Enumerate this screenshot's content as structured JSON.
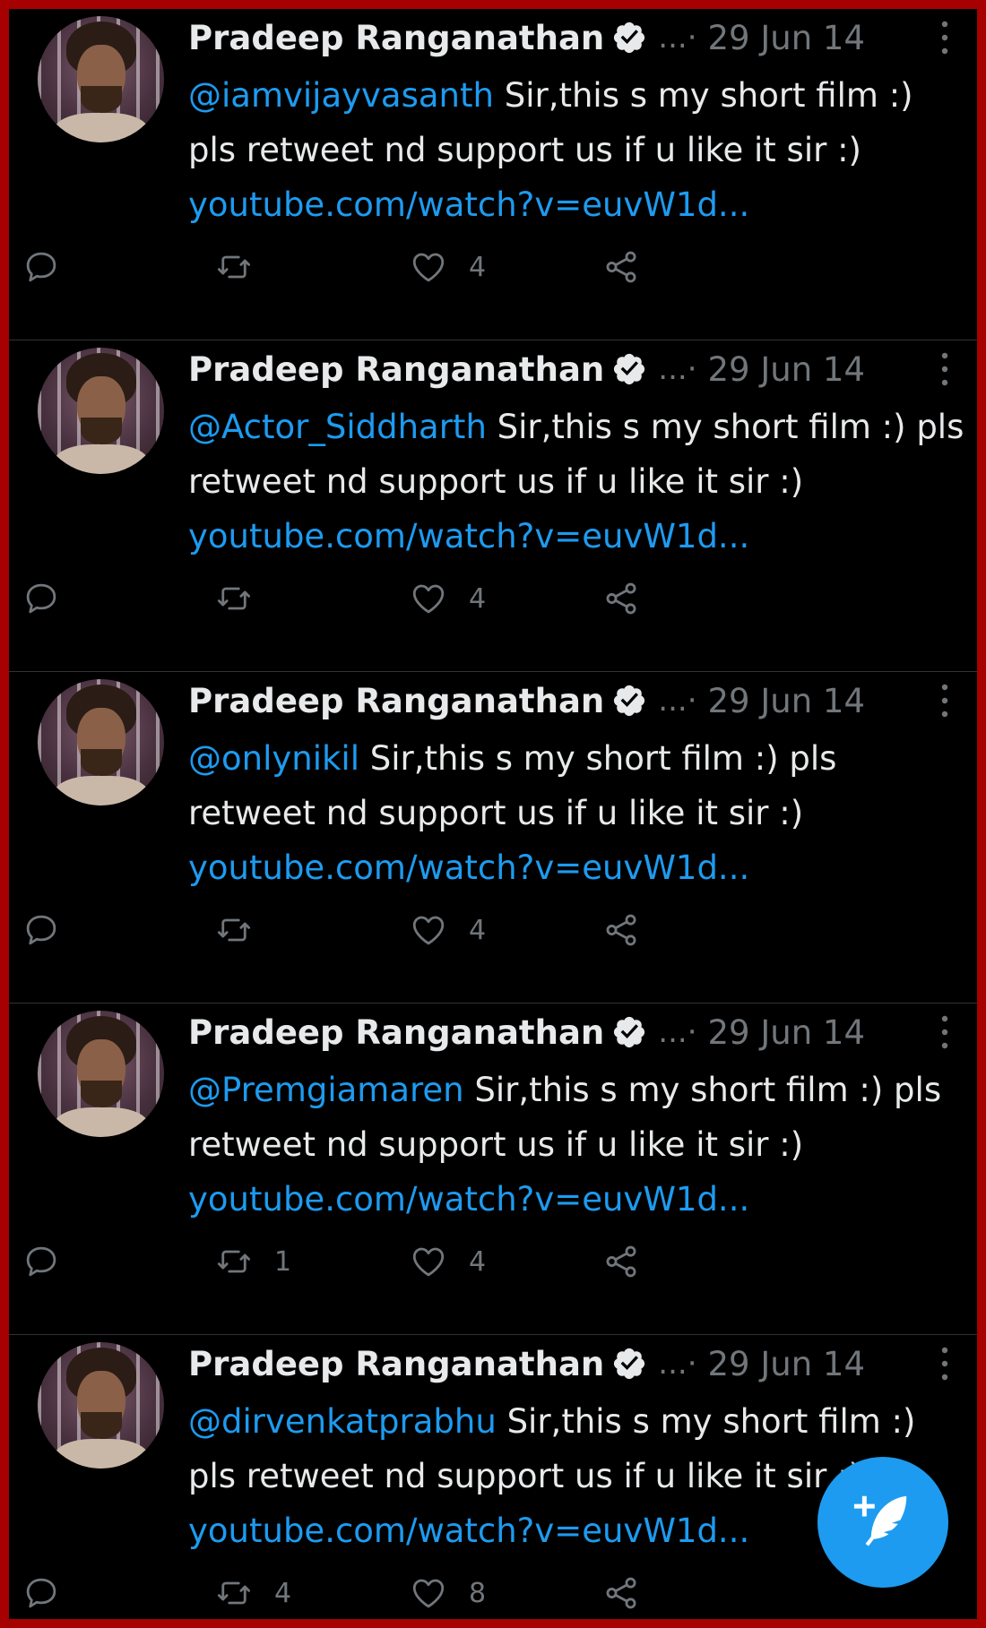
{
  "colors": {
    "background": "#000000",
    "frame_border": "#a60000",
    "link": "#1d9bf0",
    "muted": "#71767b",
    "text": "#e7e9ea",
    "fab": "#1d9bf0"
  },
  "tweets": [
    {
      "author": "Pradeep Ranganathan",
      "handle": "...·",
      "date": "29 Jun 14",
      "mention": "@iamvijayvasanth",
      "body": " Sir,this s my short film :) pls retweet nd support us if u like it sir :) ",
      "url": "youtube.com/watch?v=euvW1d...",
      "reply_count": "",
      "retweet_count": "",
      "like_count": "4"
    },
    {
      "author": "Pradeep Ranganathan",
      "handle": "...·",
      "date": "29 Jun 14",
      "mention": "@Actor_Siddharth",
      "body": " Sir,this s my short film :) pls retweet nd support us if u like it sir :) ",
      "url": "youtube.com/watch?v=euvW1d...",
      "reply_count": "",
      "retweet_count": "",
      "like_count": "4"
    },
    {
      "author": "Pradeep Ranganathan",
      "handle": "...·",
      "date": "29 Jun 14",
      "mention": "@onlynikil",
      "body": " Sir,this s my short film :) pls retweet nd support us if u like it sir :) ",
      "url": "youtube.com/watch?v=euvW1d...",
      "reply_count": "",
      "retweet_count": "",
      "like_count": "4"
    },
    {
      "author": "Pradeep Ranganathan",
      "handle": "...·",
      "date": "29 Jun 14",
      "mention": "@Premgiamaren",
      "body": " Sir,this s my short film :) pls retweet nd support us if u like it sir :) ",
      "url": "youtube.com/watch?v=euvW1d...",
      "reply_count": "",
      "retweet_count": "1",
      "like_count": "4"
    },
    {
      "author": "Pradeep Ranganathan",
      "handle": "...·",
      "date": "29 Jun 14",
      "mention": "@dirvenkatprabhu",
      "body": " Sir,this s my short film :) pls retweet nd support us if u like it sir :) ",
      "url": "youtube.com/watch?v=euvW1d...",
      "reply_count": "",
      "retweet_count": "4",
      "like_count": "8"
    }
  ],
  "icons": {
    "verified": "verified-badge-icon",
    "more": "more-vertical-icon",
    "reply": "reply-icon",
    "retweet": "retweet-icon",
    "like": "heart-icon",
    "share": "share-icon",
    "compose": "compose-tweet-icon"
  }
}
